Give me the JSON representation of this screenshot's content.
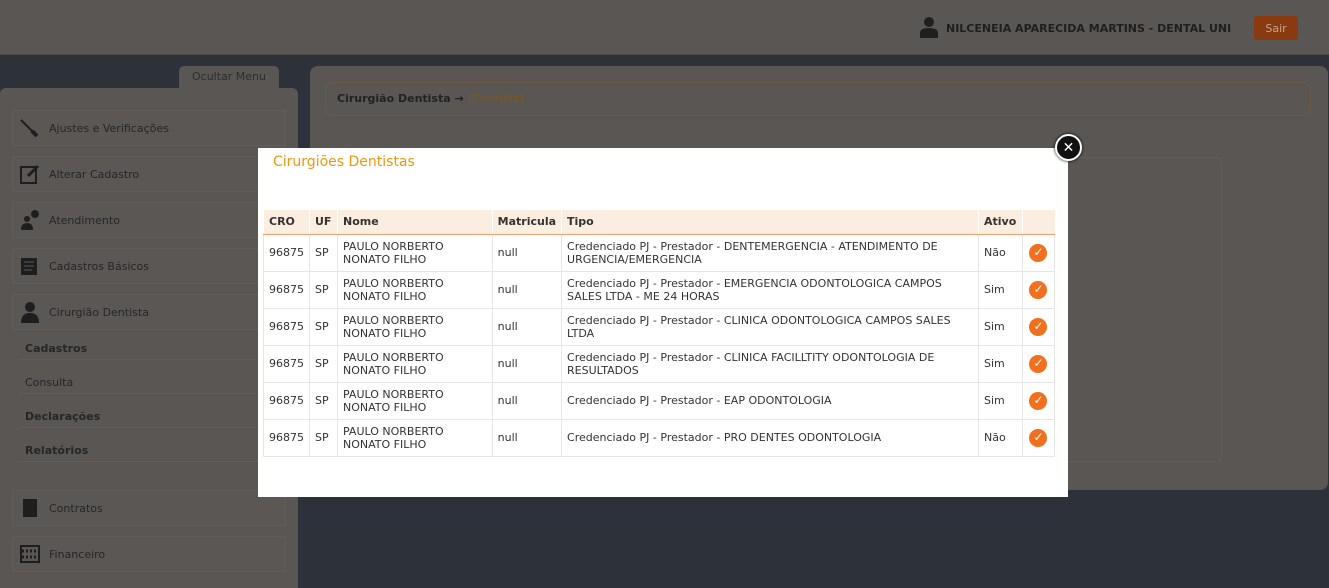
{
  "header": {
    "user_name": "NILCENEIA APARECIDA MARTINS - DENTAL UNI",
    "logout_label": "Sair"
  },
  "sidebar": {
    "toggle_label": "Ocultar Menu",
    "items": [
      {
        "label": "Ajustes e Verificações",
        "icon": "tools-icon"
      },
      {
        "label": "Alterar Cadastro",
        "icon": "edit-icon"
      },
      {
        "label": "Atendimento",
        "icon": "support-icon"
      },
      {
        "label": "Cadastros Básicos",
        "icon": "list-icon"
      },
      {
        "label": "Cirurgião Dentista",
        "icon": "user-icon"
      }
    ],
    "submenu": [
      "Cadastros",
      "Consulta",
      "Declarações",
      "Relatórios"
    ],
    "bottom_items": [
      {
        "label": "Contratos",
        "icon": "document-icon"
      },
      {
        "label": "Financeiro",
        "icon": "abacus-icon"
      }
    ]
  },
  "breadcrumb": {
    "section": "Cirurgião Dentista →",
    "current": "(Consulta)"
  },
  "modal": {
    "title": "Cirurgiões Dentistas",
    "columns": [
      "CRO",
      "UF",
      "Nome",
      "Matricula",
      "Tipo",
      "Ativo",
      ""
    ],
    "rows": [
      {
        "cro": "96875",
        "uf": "SP",
        "nome": "PAULO NORBERTO NONATO FILHO",
        "matricula": "null",
        "tipo": "Credenciado PJ - Prestador - DENTEMERGENCIA - ATENDIMENTO DE URGENCIA/EMERGENCIA",
        "ativo": "Não"
      },
      {
        "cro": "96875",
        "uf": "SP",
        "nome": "PAULO NORBERTO NONATO FILHO",
        "matricula": "null",
        "tipo": "Credenciado PJ - Prestador - EMERGENCIA ODONTOLOGICA CAMPOS SALES LTDA - ME 24 HORAS",
        "ativo": "Sim"
      },
      {
        "cro": "96875",
        "uf": "SP",
        "nome": "PAULO NORBERTO NONATO FILHO",
        "matricula": "null",
        "tipo": "Credenciado PJ - Prestador - CLINICA ODONTOLOGICA CAMPOS SALES LTDA",
        "ativo": "Sim"
      },
      {
        "cro": "96875",
        "uf": "SP",
        "nome": "PAULO NORBERTO NONATO FILHO",
        "matricula": "null",
        "tipo": "Credenciado PJ - Prestador - CLINICA FACILLTITY ODONTOLOGIA DE RESULTADOS",
        "ativo": "Sim"
      },
      {
        "cro": "96875",
        "uf": "SP",
        "nome": "PAULO NORBERTO NONATO FILHO",
        "matricula": "null",
        "tipo": "Credenciado PJ - Prestador - EAP ODONTOLOGIA",
        "ativo": "Sim"
      },
      {
        "cro": "96875",
        "uf": "SP",
        "nome": "PAULO NORBERTO NONATO FILHO",
        "matricula": "null",
        "tipo": "Credenciado PJ - Prestador - PRO DENTES ODONTOLOGIA",
        "ativo": "Não"
      }
    ]
  },
  "colors": {
    "accent": "#f26f1d",
    "title": "#f0960e"
  }
}
